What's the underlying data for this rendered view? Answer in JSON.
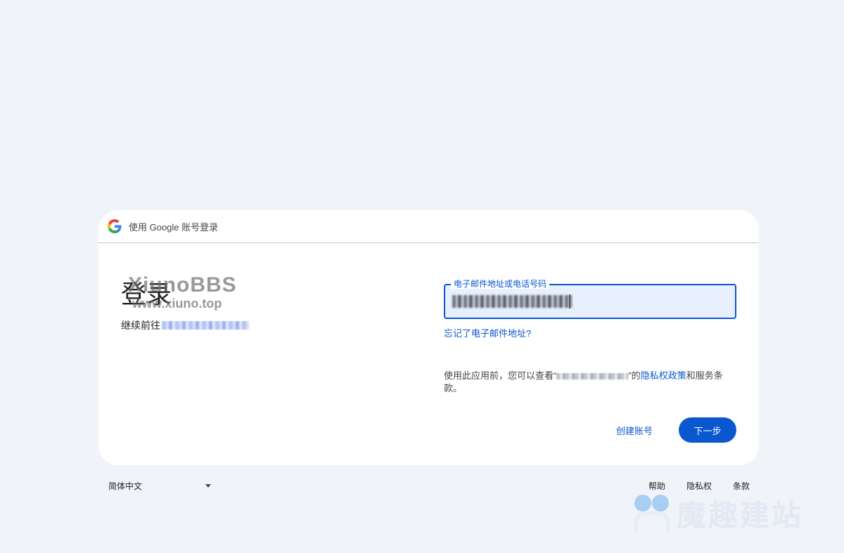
{
  "header": {
    "text": "使用 Google 账号登录"
  },
  "left": {
    "title": "登录",
    "subtitle_prefix": "继续前往"
  },
  "form": {
    "email_label": "电子邮件地址或电话号码",
    "email_value": "",
    "forgot_link": "忘记了电子邮件地址?"
  },
  "policy": {
    "before_app": "使用此应用前，您可以查看“",
    "after_app": "”的",
    "privacy_link": "隐私权政策",
    "and_terms": "和服务条款。"
  },
  "buttons": {
    "create_account": "创建账号",
    "next": "下一步"
  },
  "footer": {
    "language": "简体中文",
    "help": "帮助",
    "privacy": "隐私权",
    "terms": "条款"
  },
  "watermarks": {
    "xiuno_line1": "XiunoBBS",
    "xiuno_line2": "www.xiuno.top",
    "moqu": "魔趣建站"
  },
  "colors": {
    "primary": "#0b57d0",
    "background": "#f0f4f9",
    "field_bg": "#e8f0fe"
  }
}
